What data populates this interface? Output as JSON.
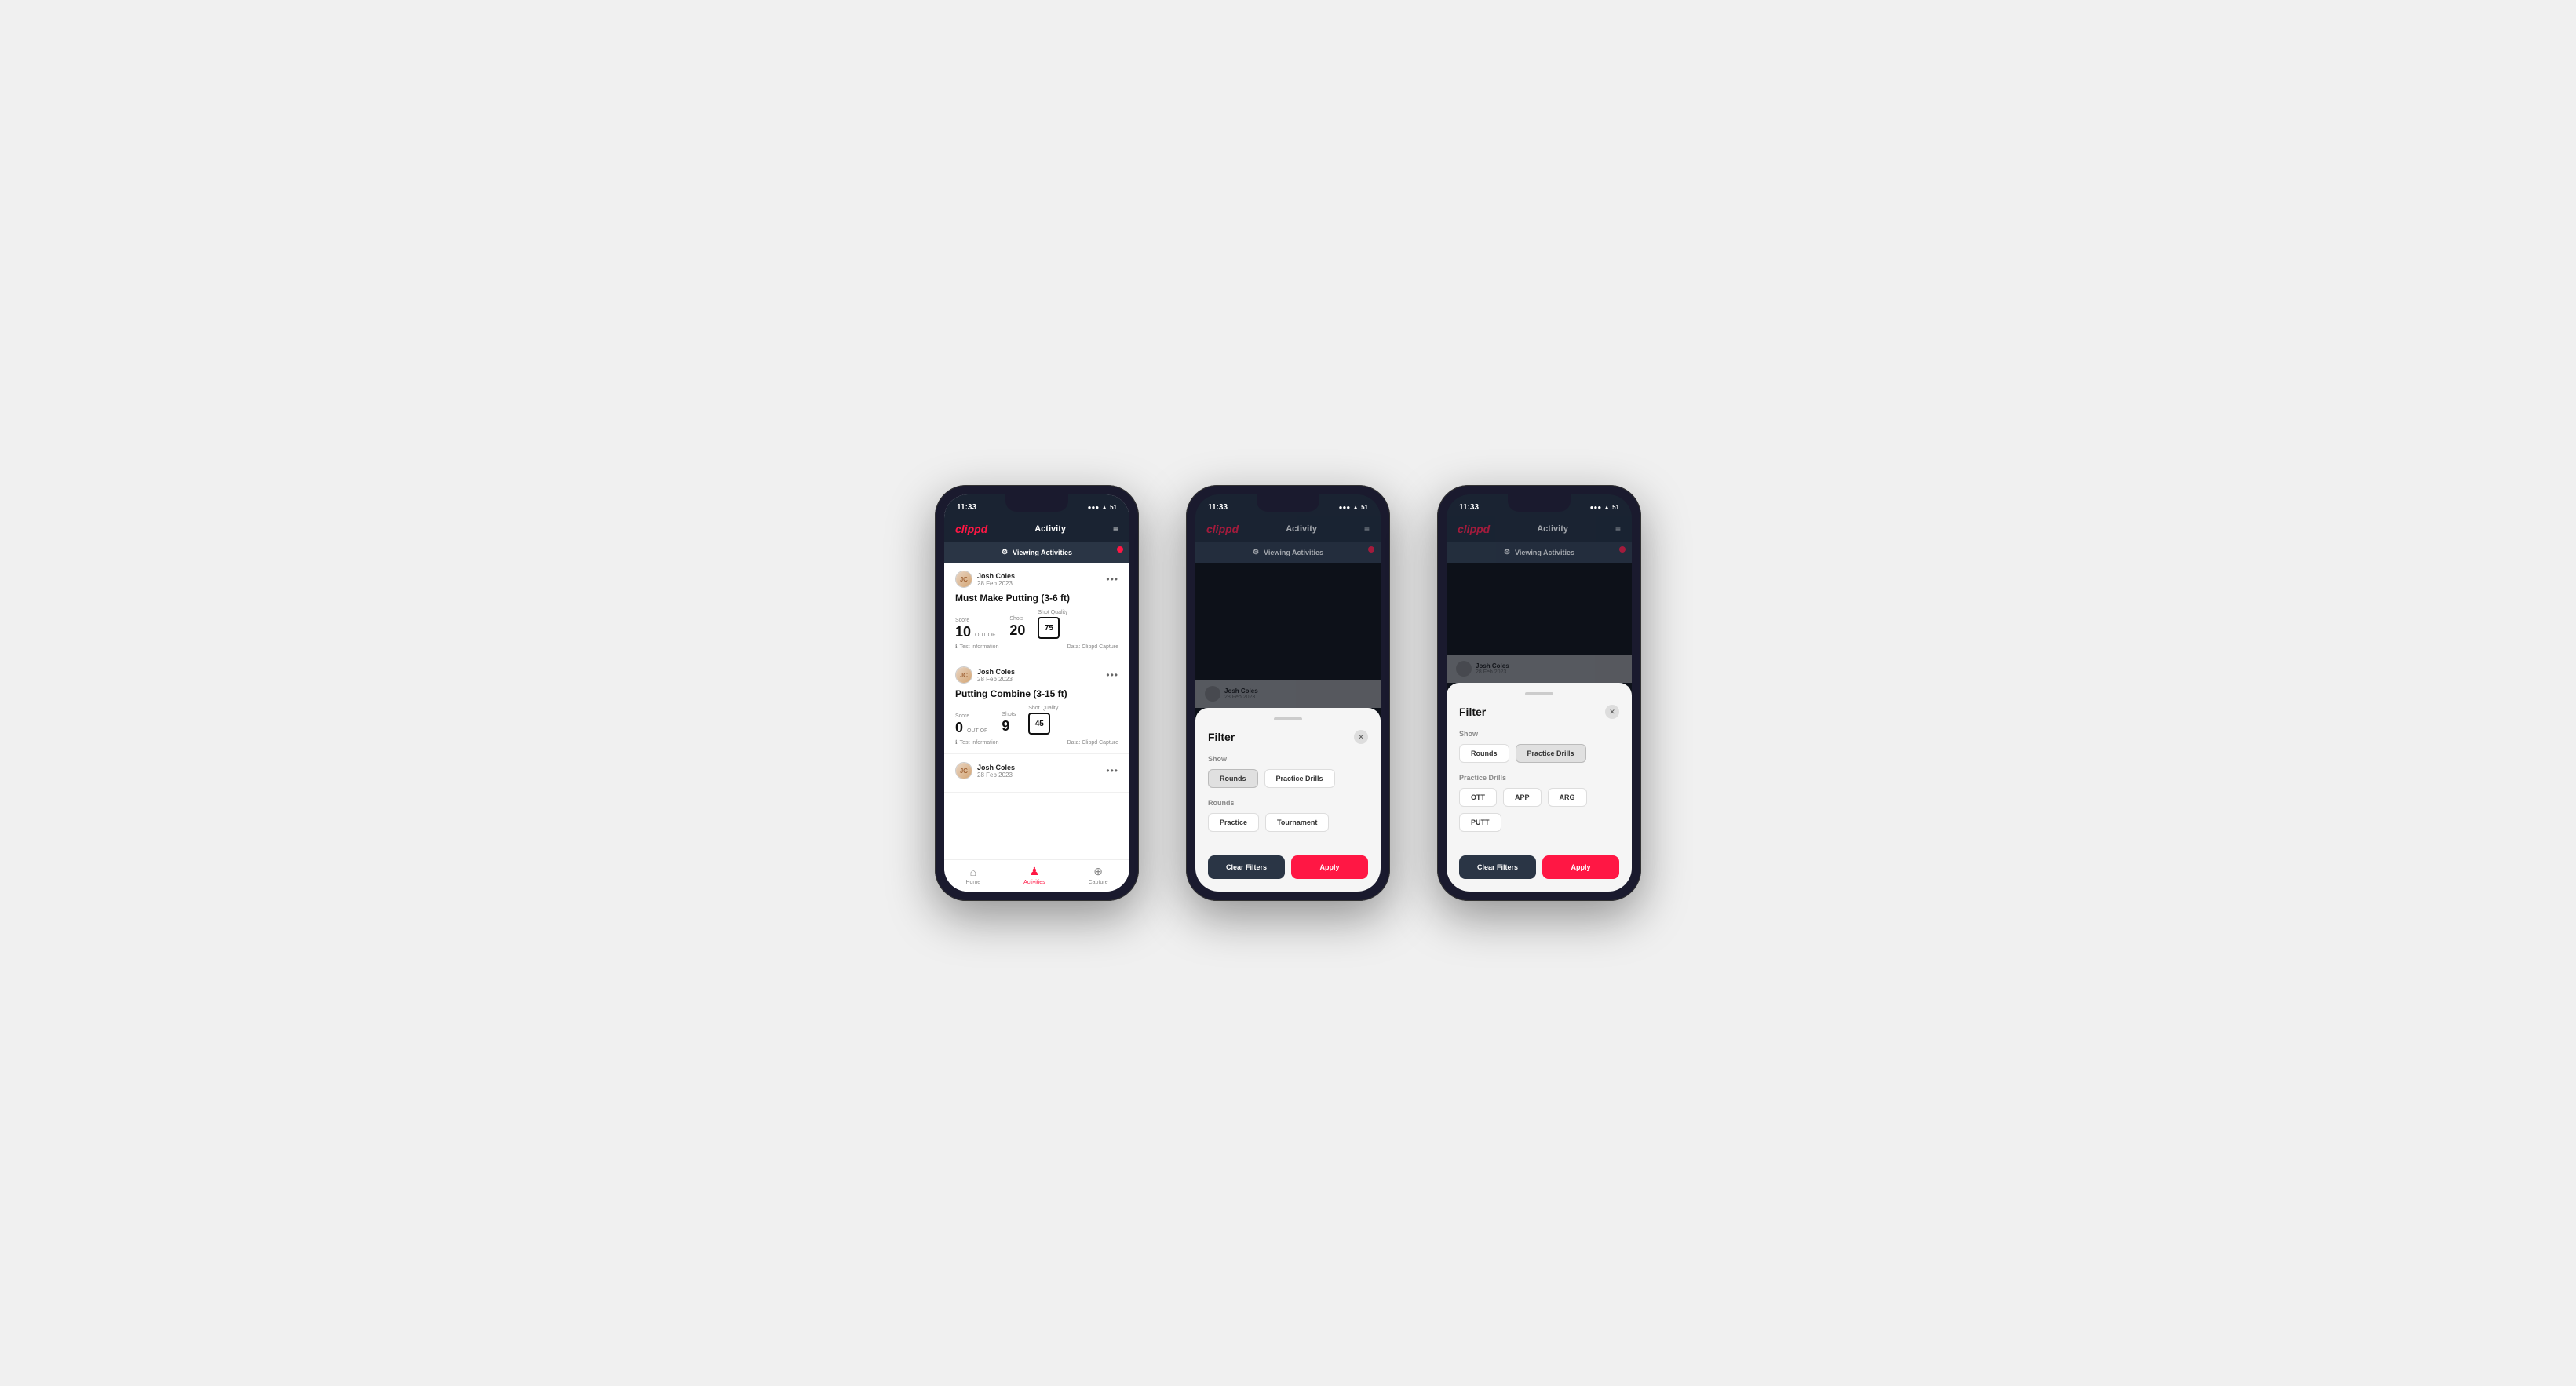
{
  "status": {
    "time": "11:33",
    "battery": "51",
    "signal": "●●●",
    "wifi": "wifi"
  },
  "header": {
    "logo": "clippd",
    "title": "Activity",
    "menu_icon": "≡"
  },
  "viewing_bar": {
    "label": "Viewing Activities",
    "icon": "⚙"
  },
  "phone1": {
    "cards": [
      {
        "user_name": "Josh Coles",
        "user_date": "28 Feb 2023",
        "title": "Must Make Putting (3-6 ft)",
        "score_label": "Score",
        "score": "10",
        "out_of": "OUT OF",
        "shots_label": "Shots",
        "shots": "20",
        "shot_quality_label": "Shot Quality",
        "shot_quality": "75",
        "test_info": "Test Information",
        "data_source": "Data: Clippd Capture"
      },
      {
        "user_name": "Josh Coles",
        "user_date": "28 Feb 2023",
        "title": "Putting Combine (3-15 ft)",
        "score_label": "Score",
        "score": "0",
        "out_of": "OUT OF",
        "shots_label": "Shots",
        "shots": "9",
        "shot_quality_label": "Shot Quality",
        "shot_quality": "45",
        "test_info": "Test Information",
        "data_source": "Data: Clippd Capture"
      }
    ],
    "nav": {
      "home_label": "Home",
      "activities_label": "Activities",
      "capture_label": "Capture"
    }
  },
  "phone2": {
    "filter": {
      "title": "Filter",
      "show_label": "Show",
      "rounds_btn": "Rounds",
      "practice_drills_btn": "Practice Drills",
      "rounds_section_label": "Rounds",
      "practice_btn": "Practice",
      "tournament_btn": "Tournament",
      "clear_filters_btn": "Clear Filters",
      "apply_btn": "Apply",
      "active_tab": "rounds"
    }
  },
  "phone3": {
    "filter": {
      "title": "Filter",
      "show_label": "Show",
      "rounds_btn": "Rounds",
      "practice_drills_btn": "Practice Drills",
      "practice_drills_section_label": "Practice Drills",
      "ott_btn": "OTT",
      "app_btn": "APP",
      "arg_btn": "ARG",
      "putt_btn": "PUTT",
      "clear_filters_btn": "Clear Filters",
      "apply_btn": "Apply",
      "active_tab": "practice_drills"
    }
  }
}
